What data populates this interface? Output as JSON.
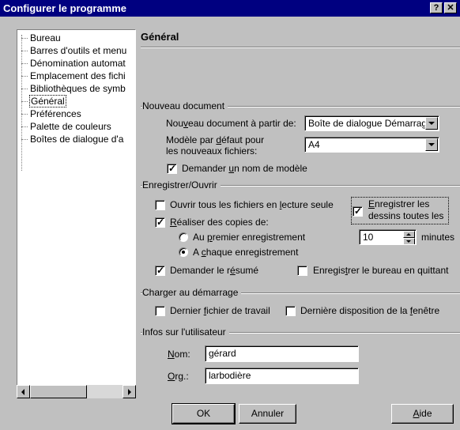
{
  "window": {
    "title": "Configurer le programme",
    "help_btn": "?",
    "close_btn": "✕"
  },
  "tree": {
    "items": [
      {
        "label": "Bureau"
      },
      {
        "label": "Barres d'outils et menu"
      },
      {
        "label": "Dénomination automat"
      },
      {
        "label": "Emplacement des fichi"
      },
      {
        "label": "Bibliothèques de symb"
      },
      {
        "label": "Général",
        "selected": true
      },
      {
        "label": "Préférences"
      },
      {
        "label": "Palette de couleurs"
      },
      {
        "label": "Boîtes de dialogue d'a"
      }
    ]
  },
  "page": {
    "title": "Général"
  },
  "nouveau_document": {
    "group_label": "Nouveau document",
    "from_label_pre": "Nou",
    "from_label_key": "v",
    "from_label_post": "eau document à partir de:",
    "from_value": "Boîte de dialogue Démarrage",
    "model_label_line1": "Modèle par ",
    "model_label_key": "d",
    "model_label_line1_post": "éfaut pour",
    "model_label_line2": "les nouveaux fichiers:",
    "model_value": "A4",
    "ask_model_pre": "Demander ",
    "ask_model_key": "u",
    "ask_model_post": "n nom de modèle",
    "ask_model_checked": true
  },
  "enregistrer": {
    "group_label": "Enregistrer/Ouvrir",
    "open_readonly_pre": "Ouvrir tous les fichiers en ",
    "open_readonly_key": "l",
    "open_readonly_post": "ecture seule",
    "open_readonly_checked": false,
    "copies_key": "R",
    "copies_post": "éaliser des copies de:",
    "copies_checked": true,
    "first_save_pre": "Au ",
    "first_save_key": "p",
    "first_save_post": "remier enregistrement",
    "each_save_pre": "A ",
    "each_save_key": "c",
    "each_save_post": "haque enregistrement",
    "selected_radio": "each_save",
    "save_drawings_key": "E",
    "save_drawings_line1_post": "nregistrer les",
    "save_drawings_line2": "dessins toutes les",
    "save_drawings_checked": true,
    "interval_value": "10",
    "interval_unit": "minutes",
    "ask_summary_pre": "Demander le r",
    "ask_summary_key": "é",
    "ask_summary_post": "sumé",
    "ask_summary_checked": true,
    "save_desktop_pre": "Enregis",
    "save_desktop_key": "t",
    "save_desktop_post": "rer le bureau en quittant",
    "save_desktop_checked": false
  },
  "charger": {
    "group_label": "Charger au démarrage",
    "last_file_pre": "Dernier ",
    "last_file_key": "f",
    "last_file_post": "ichier de travail",
    "last_file_checked": false,
    "last_layout_pre": "Dernière disposition de la ",
    "last_layout_key": "f",
    "last_layout_post": "enêtre",
    "last_layout_checked": false
  },
  "user": {
    "group_label": "Infos sur l'utilisateur",
    "name_key": "N",
    "name_post": "om:",
    "name_value": "gérard",
    "org_key": "O",
    "org_post": "rg.:",
    "org_value": "larbodière"
  },
  "buttons": {
    "ok": "OK",
    "cancel": "Annuler",
    "help_key": "A",
    "help_post": "ide"
  }
}
